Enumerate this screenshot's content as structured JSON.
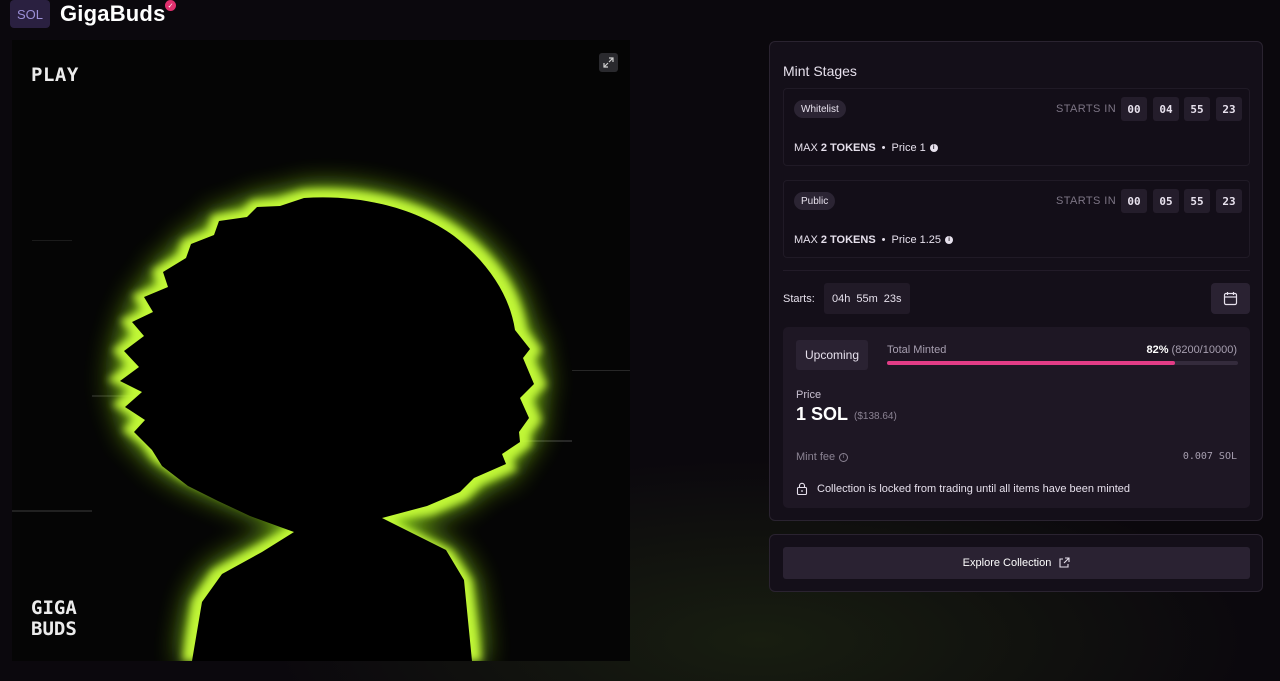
{
  "header": {
    "chain_badge": "SOL",
    "collection_name": "GigaBuds",
    "verified_icon": "check-badge-icon"
  },
  "artwork": {
    "play_label": "PLAY",
    "logo_line1": "GIGA",
    "logo_line2": "BUDS",
    "expand_icon": "expand-icon",
    "glow_color": "#9ef01a"
  },
  "mint_stages": {
    "title": "Mint Stages",
    "starts_in_label": "STARTS IN",
    "stages": [
      {
        "name": "Whitelist",
        "countdown": [
          "00",
          "04",
          "55",
          "23"
        ],
        "max_prefix": "MAX",
        "max_tokens": "2 TOKENS",
        "price_text": "Price 1"
      },
      {
        "name": "Public",
        "countdown": [
          "00",
          "05",
          "55",
          "23"
        ],
        "max_prefix": "MAX",
        "max_tokens": "2 TOKENS",
        "price_text": "Price 1.25"
      }
    ]
  },
  "starts": {
    "label": "Starts:",
    "hours": "04h",
    "minutes": "55m",
    "seconds": "23s",
    "calendar_icon": "calendar-icon"
  },
  "mint_status": {
    "status_label": "Upcoming",
    "total_minted_label": "Total Minted",
    "percent": "82%",
    "counts": "(8200/10000)",
    "progress_fraction": 0.82,
    "price_label": "Price",
    "price_value": "1 SOL",
    "price_usd": "($138.64)",
    "fee_label": "Mint fee",
    "fee_value": "0.007 SOL",
    "lock_note": "Collection is locked from trading until all items have been minted",
    "lock_icon": "lock-icon"
  },
  "explore": {
    "label": "Explore Collection",
    "icon": "external-link-icon"
  },
  "colors": {
    "accent": "#e23c86",
    "panel_bg": "#140f19",
    "chain_badge_bg": "#2a2040"
  }
}
